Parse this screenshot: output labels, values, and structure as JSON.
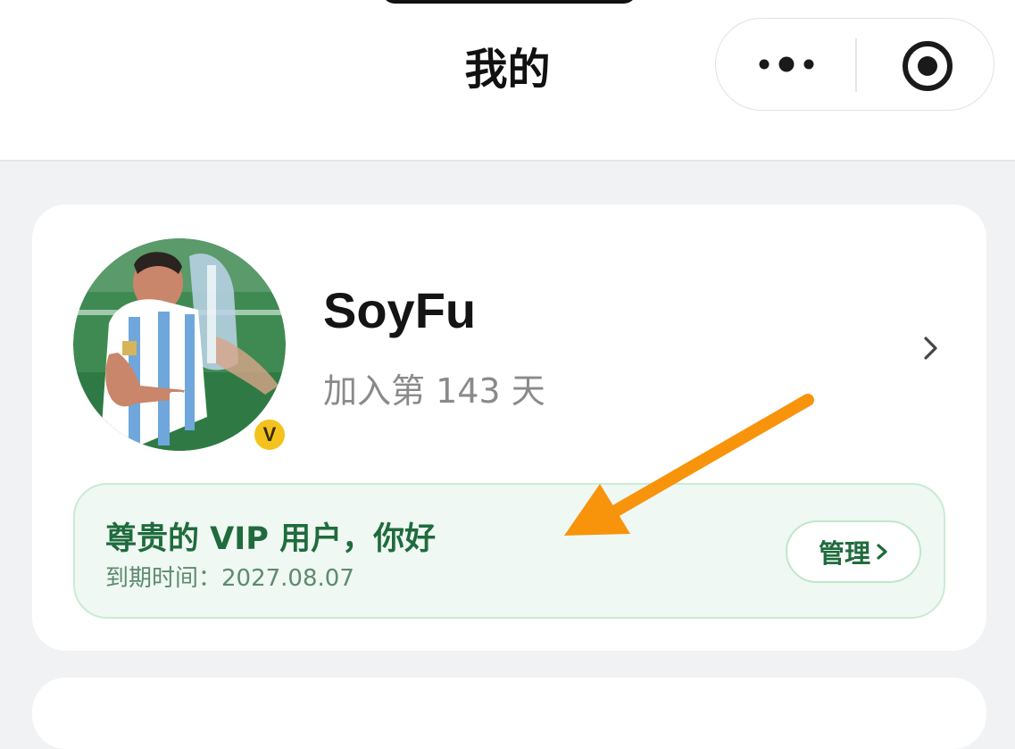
{
  "header": {
    "title": "我的",
    "more_icon": "more-icon",
    "target_icon": "target-icon"
  },
  "profile": {
    "username": "SoyFu",
    "join_days": "加入第 143 天",
    "badge": "V",
    "badge_color": "#f3c21d"
  },
  "vip": {
    "greeting": "尊贵的 VIP 用户，你好",
    "expiry": "到期时间：2027.08.07",
    "manage_label": "管理",
    "accent_color": "#1f6b3d",
    "background_color": "#eff8f2"
  },
  "annotation": {
    "arrow_color": "#f7940c"
  }
}
